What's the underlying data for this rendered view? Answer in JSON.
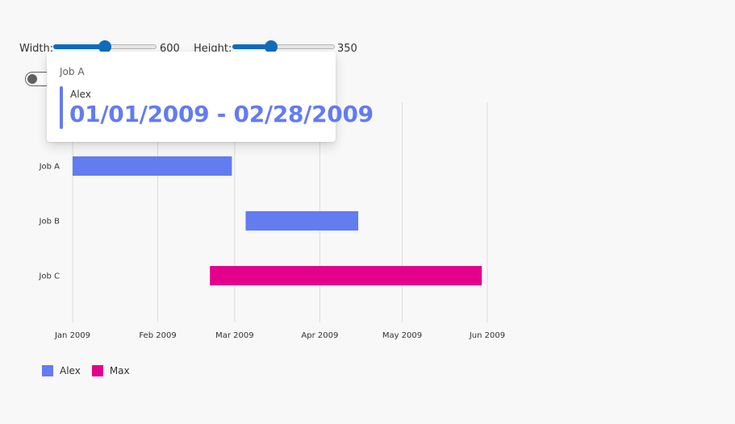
{
  "controls": {
    "width_label": "Width:",
    "width_value": "600",
    "width_min": 200,
    "width_max": 1000,
    "height_label": "Height:",
    "height_value": "350",
    "height_min": 200,
    "height_max": 600
  },
  "tooltip": {
    "title": "Job A",
    "legend": "Alex",
    "value": "01/01/2009 - 02/28/2009"
  },
  "chart_data": {
    "type": "gantt",
    "title": "",
    "xlabel": "",
    "ylabel": "",
    "categories": [
      "Job A",
      "Job B",
      "Job C"
    ],
    "x_ticks": [
      "Jan 2009",
      "Feb 2009",
      "Mar 2009",
      "Apr 2009",
      "May 2009",
      "Jun 2009"
    ],
    "x_tick_dates": [
      "2009-01-01",
      "2009-02-01",
      "2009-03-01",
      "2009-04-01",
      "2009-05-01",
      "2009-06-01"
    ],
    "xlim": [
      "2009-01-01",
      "2009-06-01"
    ],
    "grid": true,
    "legend_position": "bottom-left",
    "series": [
      {
        "name": "Alex",
        "color": "#637cef"
      },
      {
        "name": "Max",
        "color": "#e3008c"
      }
    ],
    "bars": [
      {
        "category": "Job A",
        "series": "Alex",
        "start": "2009-01-01",
        "end": "2009-02-28"
      },
      {
        "category": "Job B",
        "series": "Alex",
        "start": "2009-03-05",
        "end": "2009-04-15"
      },
      {
        "category": "Job C",
        "series": "Max",
        "start": "2009-02-20",
        "end": "2009-05-30"
      }
    ]
  }
}
